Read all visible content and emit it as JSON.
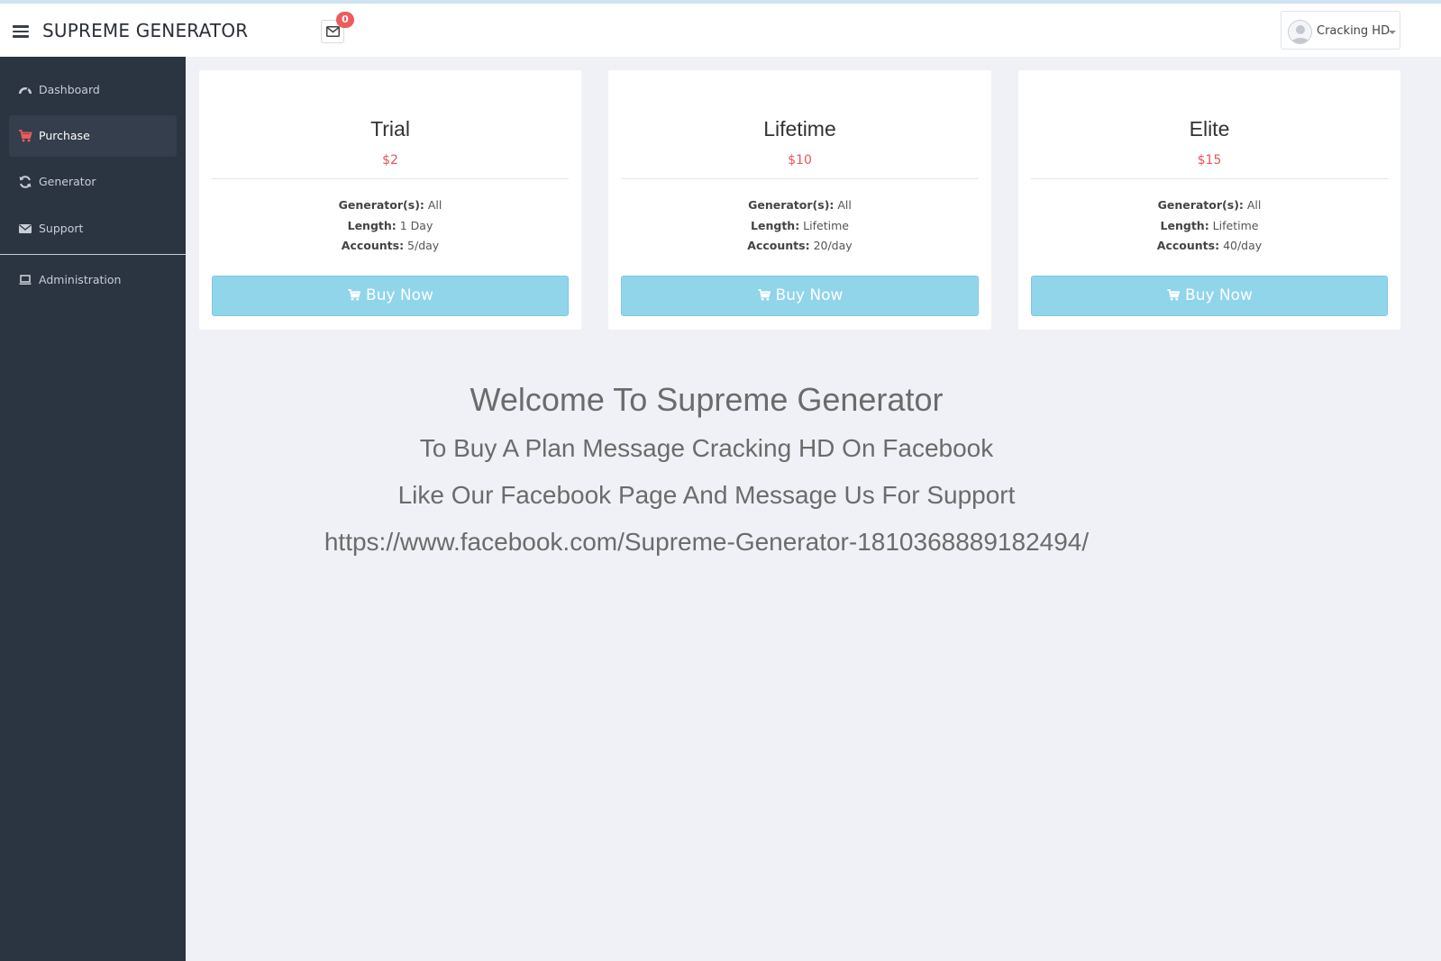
{
  "header": {
    "brand": "SUPREME GENERATOR",
    "mail_count": "0",
    "user_name": "Cracking HD"
  },
  "sidebar": {
    "items": [
      {
        "label": "Dashboard",
        "icon": "dashboard-icon"
      },
      {
        "label": "Purchase",
        "icon": "cart-icon",
        "active": true
      },
      {
        "label": "Generator",
        "icon": "refresh-icon"
      },
      {
        "label": "Support",
        "icon": "envelope-icon"
      },
      {
        "label": "Administration",
        "icon": "laptop-icon"
      }
    ]
  },
  "plans": [
    {
      "title": "Trial",
      "price": "$2",
      "generators_label": "Generator(s):",
      "generators": " All",
      "length_label": "Length:",
      "length": " 1 Day",
      "accounts_label": "Accounts:",
      "accounts": " 5/day",
      "button": "Buy Now"
    },
    {
      "title": "Lifetime",
      "price": "$10",
      "generators_label": "Generator(s):",
      "generators": " All",
      "length_label": "Length:",
      "length": " Lifetime",
      "accounts_label": "Accounts:",
      "accounts": " 20/day",
      "button": "Buy Now"
    },
    {
      "title": "Elite",
      "price": "$15",
      "generators_label": "Generator(s):",
      "generators": " All",
      "length_label": "Length:",
      "length": " Lifetime",
      "accounts_label": "Accounts:",
      "accounts": " 40/day",
      "button": "Buy Now"
    }
  ],
  "welcome": {
    "line1": "Welcome To Supreme Generator",
    "line2": "To Buy A Plan Message Cracking HD On Facebook",
    "line3": "Like Our Facebook Page And Message Us For Support",
    "line4": "https://www.facebook.com/Supreme-Generator-1810368889182494/"
  },
  "colors": {
    "sidebar_bg": "#2b3441",
    "accent_red": "#e8555a",
    "button_blue": "#91d5ea",
    "page_bg": "#f0f1f6"
  }
}
